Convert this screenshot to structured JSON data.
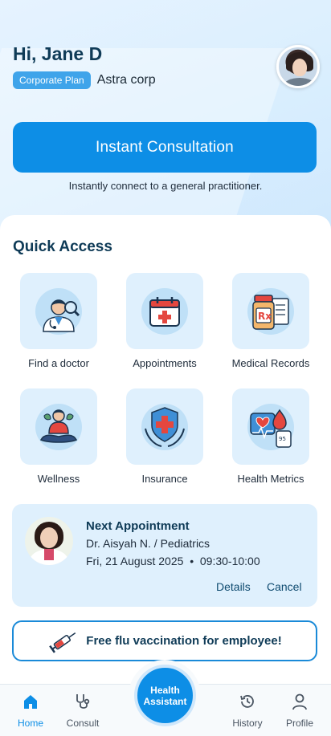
{
  "header": {
    "greeting": "Hi, Jane D",
    "plan_badge": "Corporate Plan",
    "company": "Astra corp"
  },
  "consult": {
    "button_label": "Instant Consultation",
    "subtitle": "Instantly connect to a general practitioner."
  },
  "quick_access": {
    "title": "Quick Access",
    "items": [
      {
        "label": "Find a doctor",
        "icon": "doctor-search-icon"
      },
      {
        "label": "Appointments",
        "icon": "calendar-medical-icon"
      },
      {
        "label": "Medical Records",
        "icon": "prescription-icon"
      },
      {
        "label": "Wellness",
        "icon": "meditation-icon"
      },
      {
        "label": "Insurance",
        "icon": "shield-hands-icon"
      },
      {
        "label": "Health Metrics",
        "icon": "health-metrics-icon"
      }
    ]
  },
  "appointment": {
    "title": "Next Appointment",
    "doctor": "Dr. Aisyah N. / Pediatrics",
    "datetime": "Fri, 21 August 2025  •  09:30-10:00",
    "details_label": "Details",
    "cancel_label": "Cancel"
  },
  "promo": {
    "text": "Free flu vaccination for employee!"
  },
  "nav": {
    "home": "Home",
    "consult": "Consult",
    "assistant_line1": "Health",
    "assistant_line2": "Assistant",
    "history": "History",
    "profile": "Profile"
  },
  "colors": {
    "primary": "#0d8ee6",
    "heading": "#0f3b57",
    "tile_bg": "#dff0fd"
  }
}
